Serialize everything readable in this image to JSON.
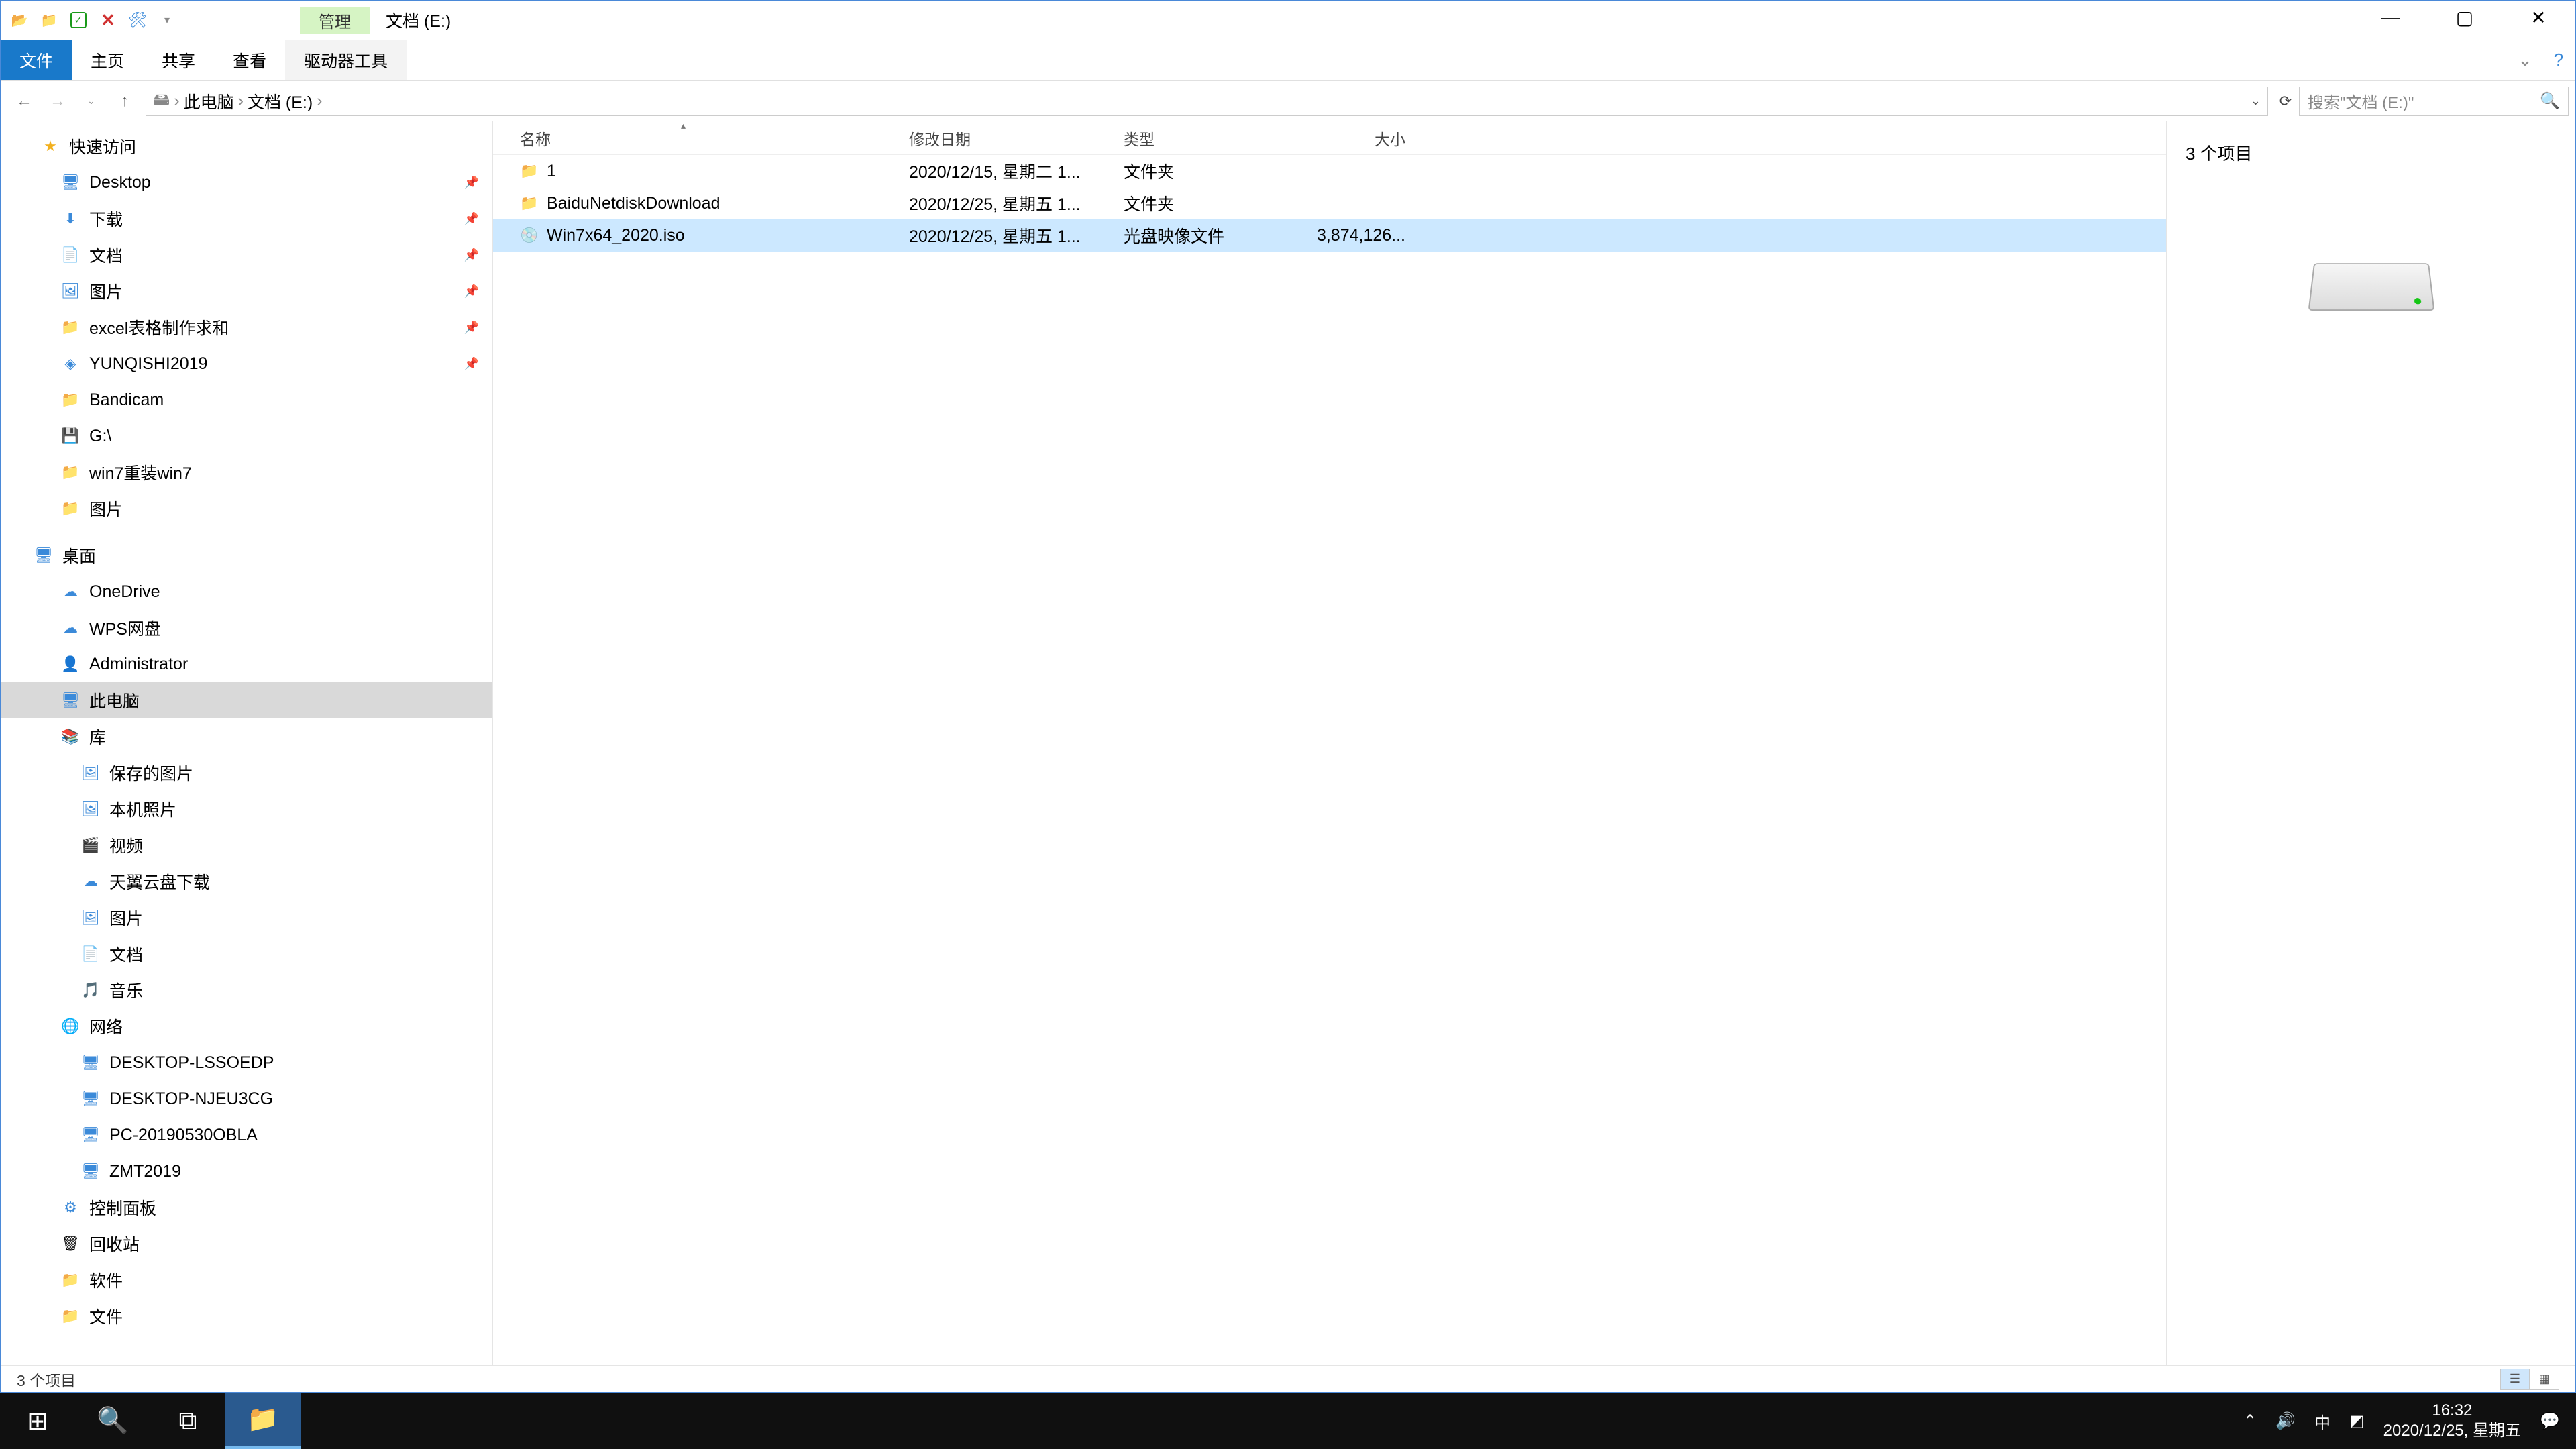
{
  "titlebar": {
    "manage_tab": "管理",
    "title": "文档 (E:)"
  },
  "ribbon": {
    "file": "文件",
    "home": "主页",
    "share": "共享",
    "view": "查看",
    "drive_tools": "驱动器工具"
  },
  "address": {
    "crumb1": "此电脑",
    "crumb2": "文档 (E:)",
    "search_placeholder": "搜索\"文档 (E:)\""
  },
  "nav": {
    "quick_access": "快速访问",
    "desktop": "Desktop",
    "downloads": "下载",
    "documents": "文档",
    "pictures": "图片",
    "excel": "excel表格制作求和",
    "yunqishi": "YUNQISHI2019",
    "bandicam": "Bandicam",
    "g_drive": "G:\\",
    "win7": "win7重装win7",
    "pictures2": "图片",
    "desktop_section": "桌面",
    "onedrive": "OneDrive",
    "wps": "WPS网盘",
    "admin": "Administrator",
    "this_pc": "此电脑",
    "libraries": "库",
    "saved_pic": "保存的图片",
    "local_photo": "本机照片",
    "videos": "视频",
    "tianyi": "天翼云盘下载",
    "pictures_lib": "图片",
    "docs_lib": "文档",
    "music": "音乐",
    "network": "网络",
    "pc1": "DESKTOP-LSSOEDP",
    "pc2": "DESKTOP-NJEU3CG",
    "pc3": "PC-20190530OBLA",
    "pc4": "ZMT2019",
    "control_panel": "控制面板",
    "recycle": "回收站",
    "software": "软件",
    "files": "文件"
  },
  "columns": {
    "name": "名称",
    "date": "修改日期",
    "type": "类型",
    "size": "大小"
  },
  "rows": [
    {
      "name": "1",
      "date": "2020/12/15, 星期二 1...",
      "type": "文件夹",
      "size": "",
      "icon": "folder",
      "selected": false
    },
    {
      "name": "BaiduNetdiskDownload",
      "date": "2020/12/25, 星期五 1...",
      "type": "文件夹",
      "size": "",
      "icon": "folder",
      "selected": false
    },
    {
      "name": "Win7x64_2020.iso",
      "date": "2020/12/25, 星期五 1...",
      "type": "光盘映像文件",
      "size": "3,874,126...",
      "icon": "iso",
      "selected": true
    }
  ],
  "preview": {
    "count": "3 个项目"
  },
  "status": {
    "text": "3 个项目"
  },
  "taskbar": {
    "time": "16:32",
    "date": "2020/12/25, 星期五",
    "ime": "中"
  }
}
